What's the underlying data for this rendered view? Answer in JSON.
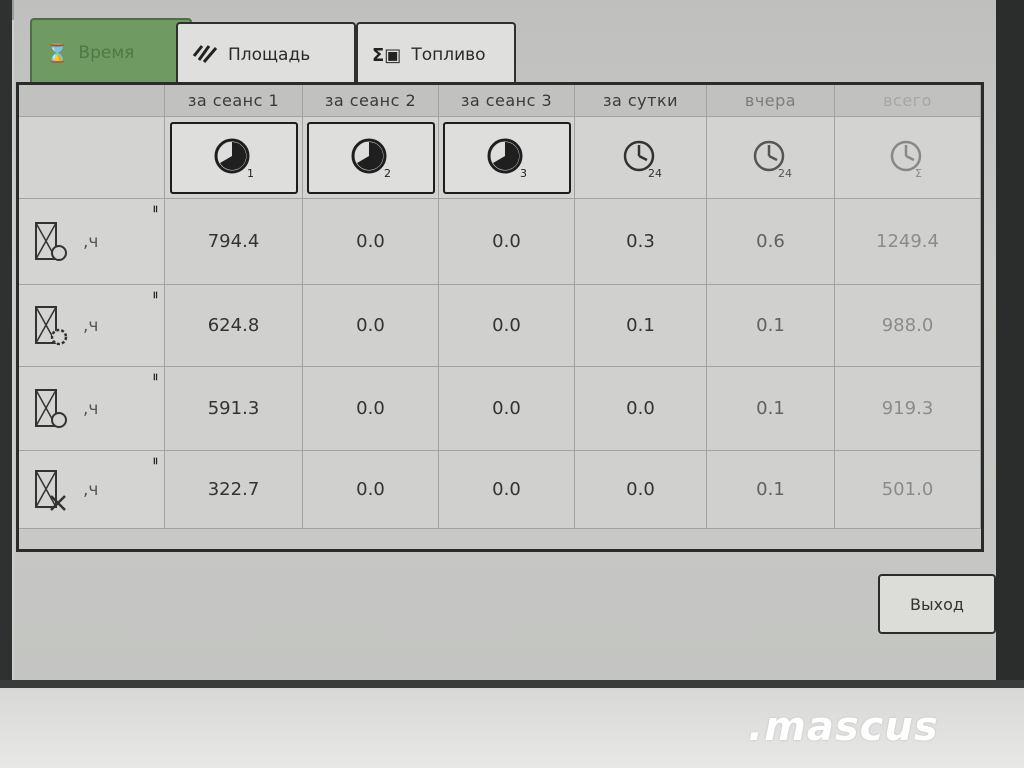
{
  "tabs": [
    {
      "label": "Время",
      "icon": "hourglass-icon",
      "active": true
    },
    {
      "label": "Площадь",
      "icon": "hatch-icon",
      "active": false
    },
    {
      "label": "Топливо",
      "icon": "sigma-fuel-icon",
      "active": false
    }
  ],
  "table": {
    "columns": [
      "за сеанс 1",
      "за сеанс 2",
      "за сеанс 3",
      "за сутки",
      "вчера",
      "всего"
    ],
    "column_icons": [
      {
        "icon": "timer-1-icon",
        "sub": "1"
      },
      {
        "icon": "timer-2-icon",
        "sub": "2"
      },
      {
        "icon": "timer-3-icon",
        "sub": "3"
      },
      {
        "icon": "clock-24-icon",
        "sub": "24"
      },
      {
        "icon": "clock-24-icon",
        "sub": "24"
      },
      {
        "icon": "clock-total-icon",
        "sub": "Σ"
      }
    ],
    "rows": [
      {
        "icon": "engine-hours-icon",
        "unit": ",ч",
        "values": [
          "794.4",
          "0.0",
          "0.0",
          "0.3",
          "0.6",
          "1249.4"
        ]
      },
      {
        "icon": "threshing-hours-icon",
        "unit": ",ч",
        "values": [
          "624.8",
          "0.0",
          "0.0",
          "0.1",
          "0.1",
          "988.0"
        ]
      },
      {
        "icon": "drive-hours-icon",
        "unit": ",ч",
        "values": [
          "591.3",
          "0.0",
          "0.0",
          "0.0",
          "0.1",
          "919.3"
        ]
      },
      {
        "icon": "idle-hours-icon",
        "unit": ",ч",
        "values": [
          "322.7",
          "0.0",
          "0.0",
          "0.0",
          "0.1",
          "501.0"
        ]
      }
    ]
  },
  "exit_button": {
    "label": "Выход"
  },
  "watermark": ".mascus"
}
